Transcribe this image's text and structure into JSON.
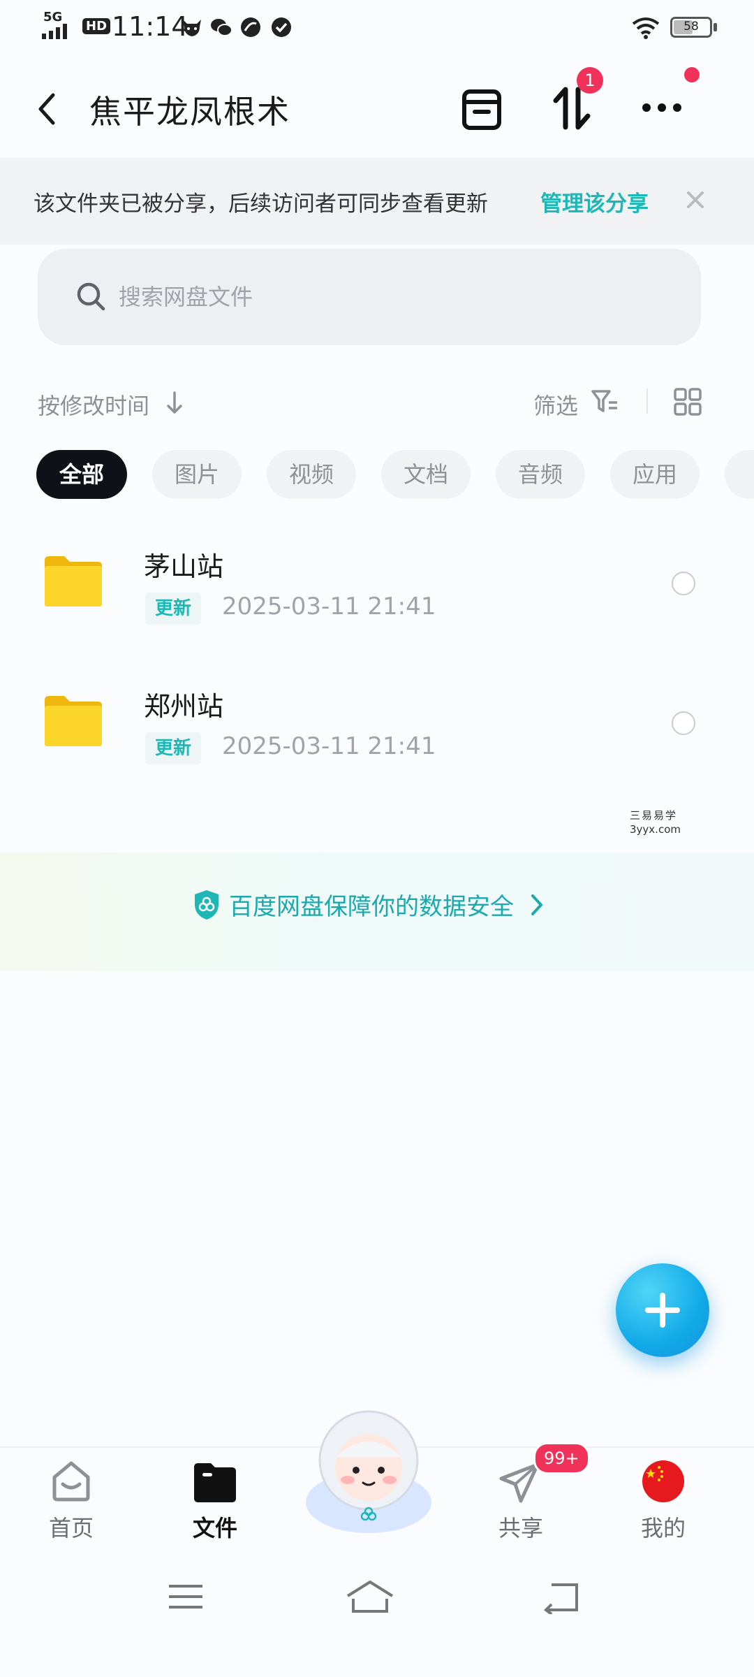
{
  "status_bar": {
    "network": "5G",
    "hd": "HD",
    "time": "11:14",
    "battery": "58",
    "battery_level": 0.58
  },
  "header": {
    "title": "焦平龙凤根术",
    "transfer_badge": "1"
  },
  "share_notice": {
    "text": "该文件夹已被分享，后续访问者可同步查看更新",
    "link": "管理该分享"
  },
  "search": {
    "placeholder": "搜索网盘文件"
  },
  "toolbar": {
    "sort_label": "按修改时间",
    "filter_label": "筛选"
  },
  "tabs": [
    {
      "label": "全部",
      "active": true
    },
    {
      "label": "图片",
      "active": false
    },
    {
      "label": "视频",
      "active": false
    },
    {
      "label": "文档",
      "active": false
    },
    {
      "label": "音频",
      "active": false
    },
    {
      "label": "应用",
      "active": false
    }
  ],
  "files": [
    {
      "name": "茅山站",
      "badge": "更新",
      "date": "2025-03-11  21:41"
    },
    {
      "name": "郑州站",
      "badge": "更新",
      "date": "2025-03-11  21:41"
    }
  ],
  "watermark": {
    "line1": "三易易学",
    "line2": "3yyx.com"
  },
  "security_banner": {
    "text": "百度网盘保障你的数据安全"
  },
  "bottom_nav": {
    "items": [
      {
        "label": "首页"
      },
      {
        "label": "文件"
      },
      {
        "label": "共享"
      },
      {
        "label": "我的"
      }
    ],
    "share_badge": "99+"
  },
  "colors": {
    "accent": "#1db7b5",
    "badge": "#f0325a",
    "fab": "#12a9e8",
    "folder": "#f8c81a"
  }
}
